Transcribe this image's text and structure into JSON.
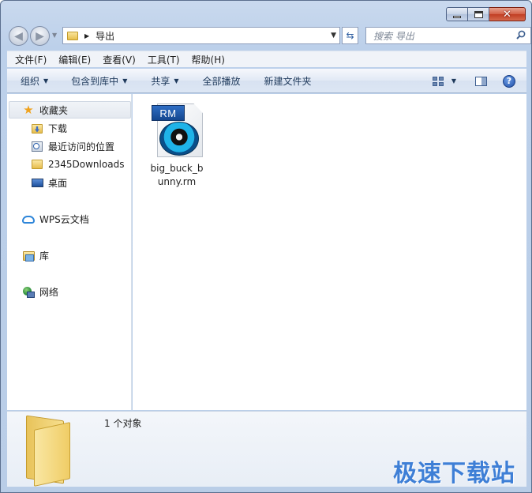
{
  "window": {
    "buttons": {
      "minimize_icon": "minimize-icon",
      "maximize_icon": "maximize-icon",
      "close_icon": "close-icon"
    }
  },
  "nav": {
    "back_icon": "back-arrow-icon",
    "forward_icon": "forward-arrow-icon",
    "address_path": "导出",
    "search_placeholder": "搜索 导出"
  },
  "menu": [
    "文件(F)",
    "编辑(E)",
    "查看(V)",
    "工具(T)",
    "帮助(H)"
  ],
  "toolbar": {
    "organize": "组织",
    "include_in_library": "包含到库中",
    "share": "共享",
    "play_all": "全部播放",
    "new_folder": "新建文件夹"
  },
  "sidebar": {
    "favorites": "收藏夹",
    "items": [
      "下载",
      "最近访问的位置",
      "2345Downloads",
      "桌面"
    ],
    "wps_cloud": "WPS云文档",
    "libraries": "库",
    "network": "网络"
  },
  "files": [
    {
      "badge": "RM",
      "name": "big_buck_bunny.rm",
      "icon": "realmedia-file-icon"
    }
  ],
  "details": {
    "count_text": "1 个对象"
  },
  "watermark": "极速下载站",
  "colors": {
    "accent": "#3e7fd6",
    "frame": "#b9cde7",
    "close_red": "#c13d22"
  }
}
